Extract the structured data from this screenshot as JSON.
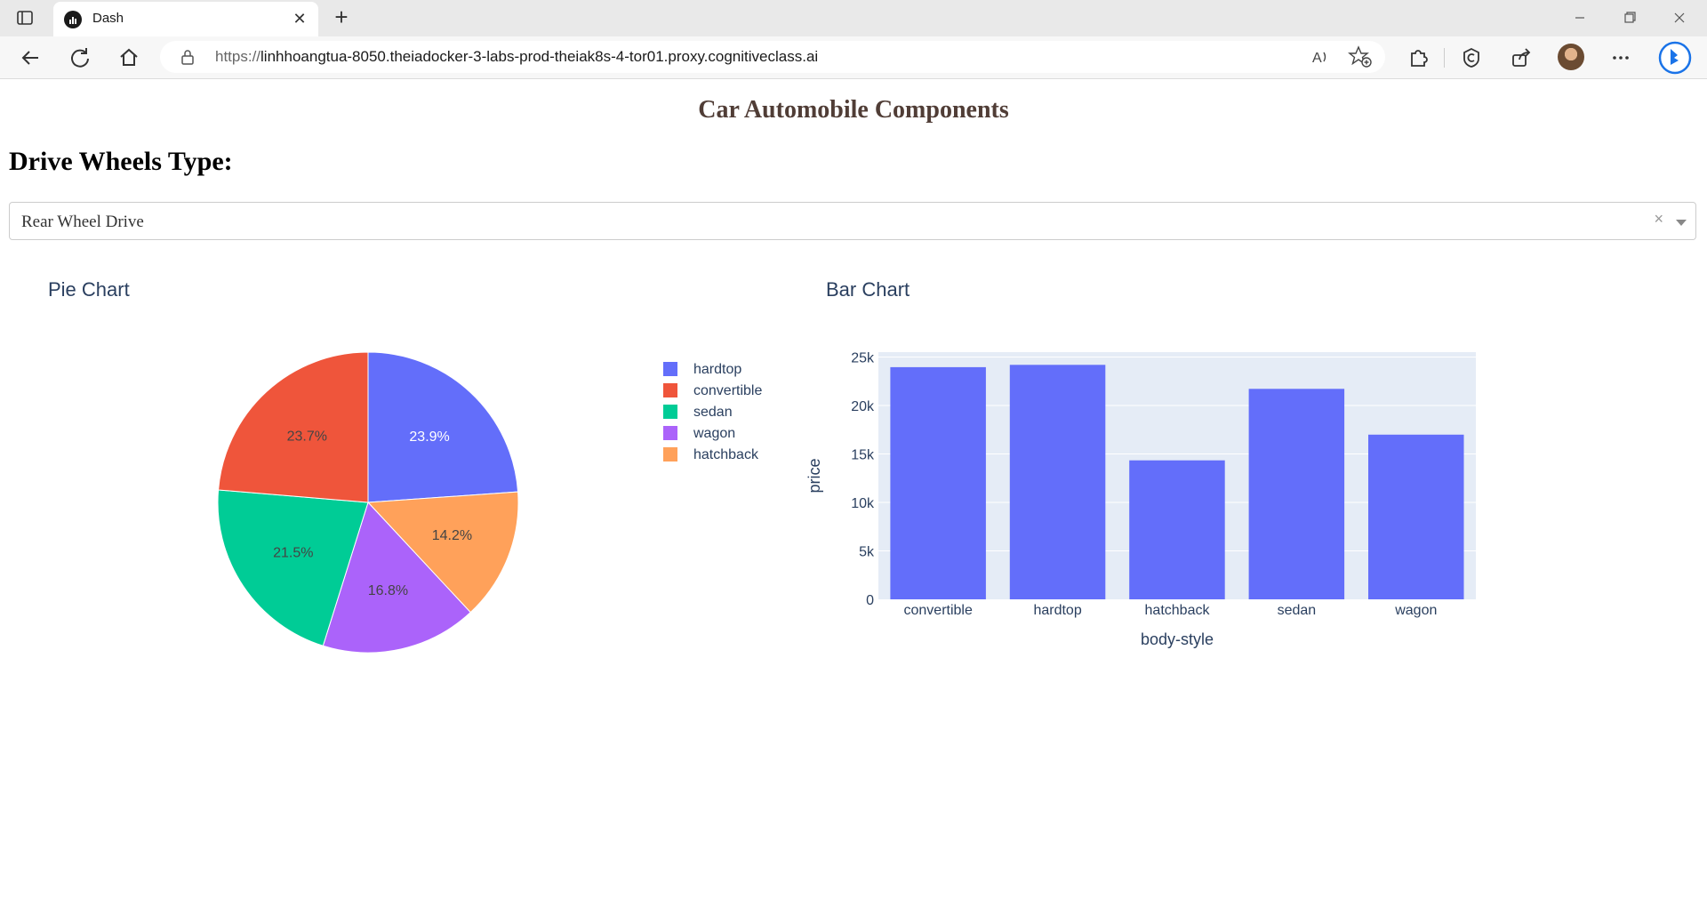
{
  "browser": {
    "tab_title": "Dash",
    "url_scheme": "https://",
    "url_host": "linhhoangtua-8050.theiadocker-3-labs-prod-theiak8s-4-tor01.proxy.cognitiveclass.ai"
  },
  "page": {
    "title": "Car Automobile Components",
    "section_label": "Drive Wheels Type:",
    "dropdown_value": "Rear Wheel Drive",
    "dropdown_clear": "×"
  },
  "pie": {
    "title": "Pie Chart"
  },
  "bar": {
    "title": "Bar Chart"
  },
  "chart_data": [
    {
      "type": "pie",
      "title": "Pie Chart",
      "labels": [
        "hardtop",
        "convertible",
        "sedan",
        "wagon",
        "hatchback"
      ],
      "values": [
        23.9,
        23.7,
        21.5,
        16.8,
        14.2
      ],
      "value_labels": [
        "23.9%",
        "23.7%",
        "21.5%",
        "16.8%",
        "14.2%"
      ],
      "slice_order": [
        "hardtop",
        "hatchback",
        "wagon",
        "sedan",
        "convertible"
      ],
      "colors": {
        "hardtop": "#636efa",
        "convertible": "#ef553b",
        "sedan": "#00cc96",
        "wagon": "#ab63fa",
        "hatchback": "#ffa15a"
      },
      "legend_position": "right"
    },
    {
      "type": "bar",
      "title": "Bar Chart",
      "categories": [
        "convertible",
        "hardtop",
        "hatchback",
        "sedan",
        "wagon"
      ],
      "values": [
        23950,
        24190,
        14340,
        21710,
        16990
      ],
      "xlabel": "body-style",
      "ylabel": "price",
      "ylim": [
        0,
        25500
      ],
      "yticks": [
        0,
        5000,
        10000,
        15000,
        20000,
        25000
      ],
      "ytick_labels": [
        "0",
        "5k",
        "10k",
        "15k",
        "20k",
        "25k"
      ],
      "bar_color": "#636efa",
      "plot_bg": "#e5ecf6",
      "grid": true
    }
  ]
}
